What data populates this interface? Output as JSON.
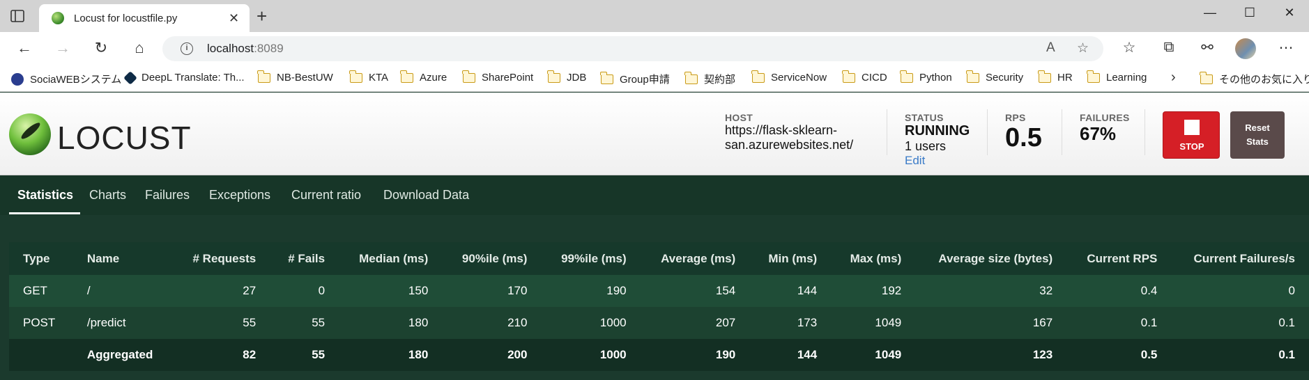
{
  "browser": {
    "tab_title": "Locust for locustfile.py",
    "url_host": "localhost",
    "url_port": ":8089",
    "bookmarks": [
      {
        "label": "SociaWEBシステム",
        "icon": "socia-favicon"
      },
      {
        "label": "DeepL Translate: Th...",
        "icon": "deepl-favicon"
      },
      {
        "label": "NB-BestUW",
        "icon": "folder-icon"
      },
      {
        "label": "KTA",
        "icon": "folder-icon"
      },
      {
        "label": "Azure",
        "icon": "folder-icon"
      },
      {
        "label": "SharePoint",
        "icon": "folder-icon"
      },
      {
        "label": "JDB",
        "icon": "folder-icon"
      },
      {
        "label": "Group申請",
        "icon": "folder-icon"
      },
      {
        "label": "契約部",
        "icon": "folder-icon"
      },
      {
        "label": "ServiceNow",
        "icon": "folder-icon"
      },
      {
        "label": "CICD",
        "icon": "folder-icon"
      },
      {
        "label": "Python",
        "icon": "folder-icon"
      },
      {
        "label": "Security",
        "icon": "folder-icon"
      },
      {
        "label": "HR",
        "icon": "folder-icon"
      },
      {
        "label": "Learning",
        "icon": "folder-icon"
      }
    ],
    "other_bookmarks": "その他のお気に入り"
  },
  "header": {
    "logo_text": "LOCUST",
    "host_label": "HOST",
    "host_line1": "https://flask-sklearn-",
    "host_line2": "san.azurewebsites.net/",
    "status_label": "STATUS",
    "status_value": "RUNNING",
    "users": "1 users",
    "edit": "Edit",
    "rps_label": "RPS",
    "rps_value": "0.5",
    "failures_label": "FAILURES",
    "failures_value": "67%",
    "stop_label": "STOP",
    "reset_line1": "Reset",
    "reset_line2": "Stats",
    "colors": {
      "stop": "#d51f26",
      "reset": "#5a4a4a",
      "link": "#3a7bc8"
    }
  },
  "nav": {
    "tabs": [
      "Statistics",
      "Charts",
      "Failures",
      "Exceptions",
      "Current ratio",
      "Download Data"
    ],
    "active": "Statistics"
  },
  "table": {
    "columns": [
      "Type",
      "Name",
      "# Requests",
      "# Fails",
      "Median (ms)",
      "90%ile (ms)",
      "99%ile (ms)",
      "Average (ms)",
      "Min (ms)",
      "Max (ms)",
      "Average size (bytes)",
      "Current RPS",
      "Current Failures/s"
    ],
    "rows": [
      [
        "GET",
        "/",
        "27",
        "0",
        "150",
        "170",
        "190",
        "154",
        "144",
        "192",
        "32",
        "0.4",
        "0"
      ],
      [
        "POST",
        "/predict",
        "55",
        "55",
        "180",
        "210",
        "1000",
        "207",
        "173",
        "1049",
        "167",
        "0.1",
        "0.1"
      ]
    ],
    "aggregated": [
      "",
      "Aggregated",
      "82",
      "55",
      "180",
      "200",
      "1000",
      "190",
      "144",
      "1049",
      "123",
      "0.5",
      "0.1"
    ]
  }
}
